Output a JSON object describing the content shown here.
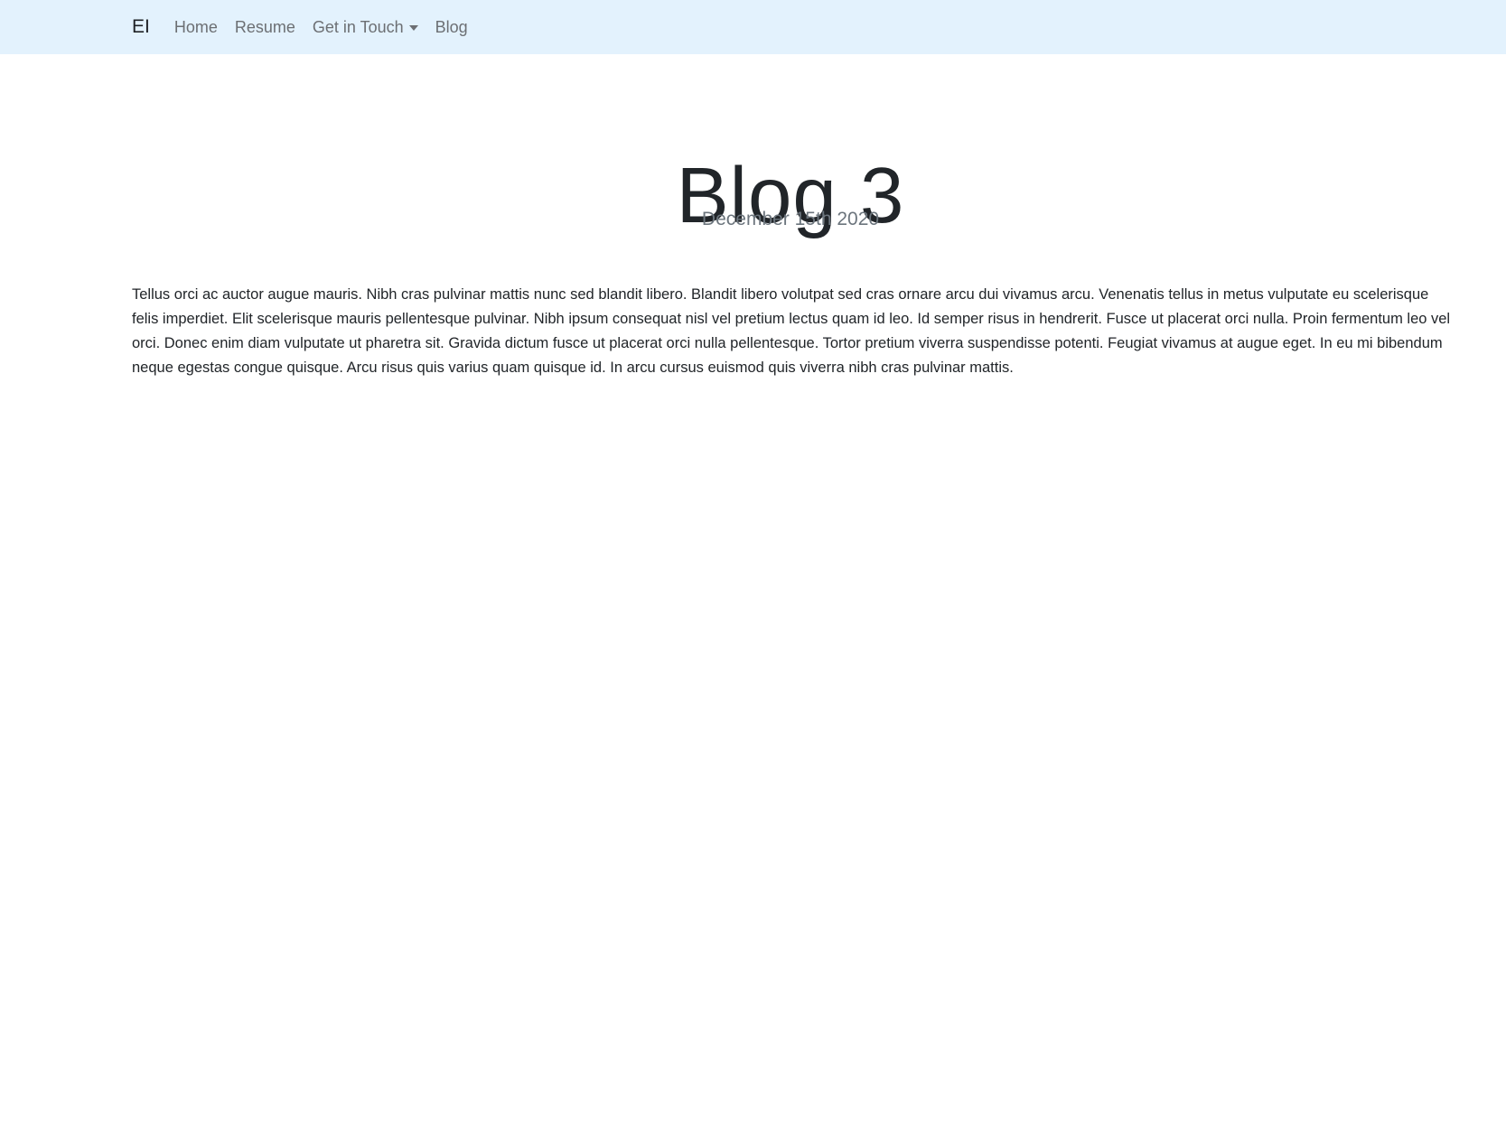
{
  "navbar": {
    "brand": "EI",
    "links": [
      {
        "label": "Home"
      },
      {
        "label": "Resume"
      },
      {
        "label": "Get in Touch",
        "has_dropdown": true
      },
      {
        "label": "Blog"
      }
    ],
    "background_color": "#e3f2fd"
  },
  "post": {
    "title": "Blog 3",
    "date": "December 15th 2020",
    "body": "Tellus orci ac auctor augue mauris. Nibh cras pulvinar mattis nunc sed blandit libero. Blandit libero volutpat sed cras ornare arcu dui vivamus arcu. Venenatis tellus in metus vulputate eu scelerisque felis imperdiet. Elit scelerisque mauris pellentesque pulvinar. Nibh ipsum consequat nisl vel pretium lectus quam id leo. Id semper risus in hendrerit. Fusce ut placerat orci nulla. Proin fermentum leo vel orci. Donec enim diam vulputate ut pharetra sit. Gravida dictum fusce ut placerat orci nulla pellentesque. Tortor pretium viverra suspendisse potenti. Feugiat vivamus at augue eget. In eu mi bibendum neque egestas congue quisque. Arcu risus quis varius quam quisque id. In arcu cursus euismod quis viverra nibh cras pulvinar mattis."
  }
}
